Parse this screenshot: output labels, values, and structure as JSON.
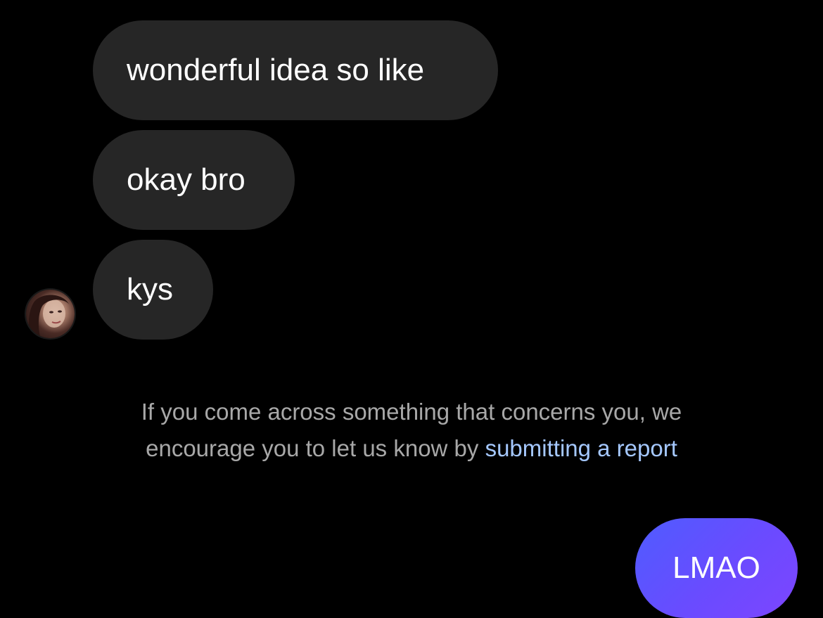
{
  "messages": [
    {
      "text": "wonderful idea so like",
      "direction": "received"
    },
    {
      "text": "okay bro",
      "direction": "received"
    },
    {
      "text": "kys",
      "direction": "received"
    }
  ],
  "sender_avatar": {
    "icon": "profile-photo"
  },
  "notice": {
    "text": "If you come across something that concerns you, we encourage you to let us know by ",
    "link_text": "submitting a report"
  },
  "sent_message": {
    "text": "LMAO",
    "direction": "sent"
  },
  "colors": {
    "background": "#000000",
    "received_bubble": "#262626",
    "sent_bubble_start": "#4f5cff",
    "sent_bubble_end": "#7d45ff",
    "notice_text": "#a8a8a8",
    "link": "#a5c8ff"
  }
}
